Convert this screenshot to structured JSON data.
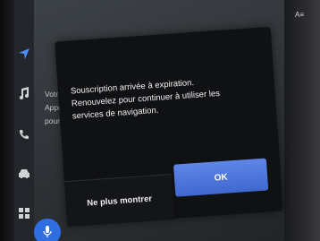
{
  "background": {
    "partial_text": [
      "Votre",
      "Appu",
      "pour l"
    ]
  },
  "sidebar": {
    "items": [
      {
        "icon": "navigation-arrow-icon"
      },
      {
        "icon": "music-note-icon"
      },
      {
        "icon": "phone-icon"
      },
      {
        "icon": "car-icon"
      },
      {
        "icon": "apps-grid-icon"
      }
    ]
  },
  "top_icon": {
    "label": "A≡"
  },
  "dialog": {
    "message_lines": [
      "Souscription arrivée à expiration.",
      "Renouvelez pour continuer à utiliser les",
      "services de navigation."
    ],
    "dismiss_label": "Ne plus montrer",
    "ok_label": "OK"
  },
  "colors": {
    "accent": "#3f67cf",
    "sidebar_active": "#2f6ee0",
    "dialog_bg": "#101113"
  }
}
